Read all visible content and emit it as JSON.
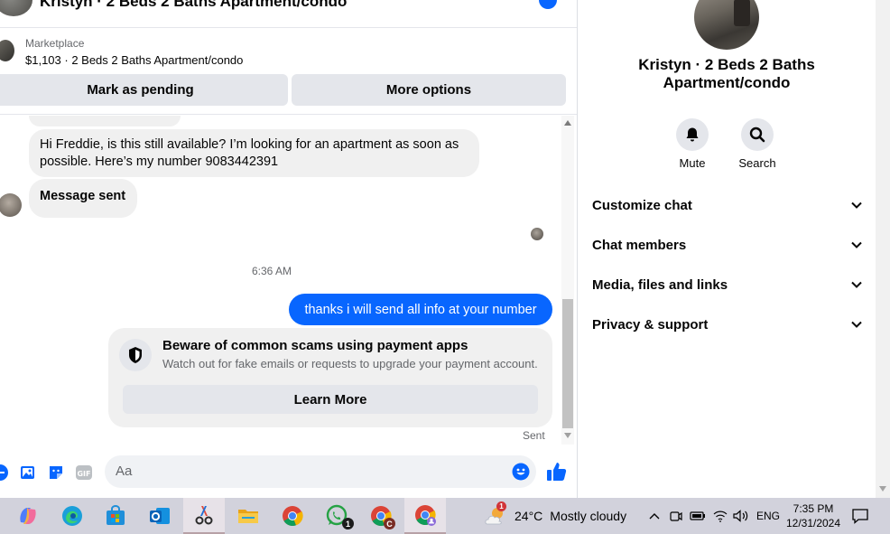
{
  "chat_header": {
    "title": "Kristyn · 2 Beds 2 Baths Apartment/condo"
  },
  "marketplace": {
    "label": "Marketplace",
    "listing": "$1,103 · 2 Beds 2 Baths Apartment/condo",
    "pending_button": "Mark as pending",
    "more_button": "More options"
  },
  "messages": {
    "incoming_1": "Hi Freddie, is this still available? I’m looking for an apartment as soon as possible. Here’s my number 9083442391",
    "incoming_2": "Message sent",
    "timestamp": "6:36 AM",
    "outgoing_1": "thanks i will send all info at your number",
    "scam_title": "Beware of common scams using payment apps",
    "scam_text": "Watch out for fake emails or requests to upgrade your payment account.",
    "scam_button": "Learn More",
    "status": "Sent"
  },
  "composer": {
    "placeholder": "Aa",
    "gif_label": "GIF"
  },
  "details": {
    "title": "Kristyn · 2 Beds 2 Baths Apartment/condo",
    "actions": [
      {
        "label": "Mute",
        "icon": "bell-icon"
      },
      {
        "label": "Search",
        "icon": "search-icon"
      }
    ],
    "sections": [
      {
        "label": "Customize chat"
      },
      {
        "label": "Chat members"
      },
      {
        "label": "Media, files and links"
      },
      {
        "label": "Privacy & support"
      }
    ]
  },
  "taskbar": {
    "apps": [
      "copilot",
      "edge",
      "microsoft-store",
      "outlook",
      "snipping-tool",
      "file-explorer",
      "chrome",
      "whatsapp",
      "chrome-profile-c",
      "chrome-profile-user"
    ],
    "whatsapp_badge": "1",
    "chrome_profile_letter": "C",
    "weather": {
      "temp": "24°C",
      "condition": "Mostly cloudy",
      "alert": "1"
    },
    "language": "ENG",
    "time": "7:35 PM",
    "date": "12/31/2024"
  },
  "colors": {
    "messenger_blue": "#0866ff",
    "bubble_gray": "#f0f0f0",
    "taskbar": "#d2d2dc"
  }
}
